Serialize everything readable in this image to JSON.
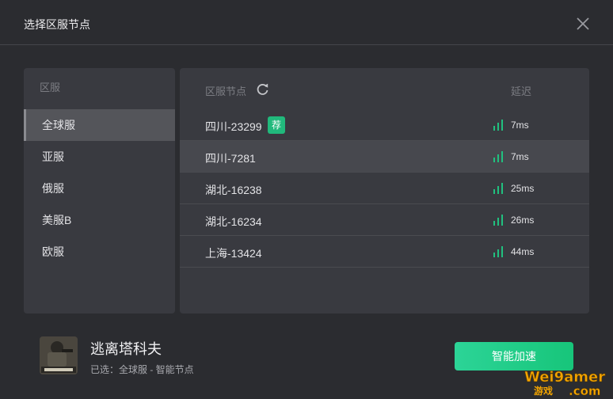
{
  "dialog": {
    "title": "选择区服节点"
  },
  "regions": {
    "header": "区服",
    "items": [
      {
        "label": "全球服",
        "selected": true
      },
      {
        "label": "亚服",
        "selected": false
      },
      {
        "label": "俄服",
        "selected": false
      },
      {
        "label": "美服B",
        "selected": false
      },
      {
        "label": "欧服",
        "selected": false
      }
    ]
  },
  "nodes": {
    "header": "区服节点",
    "latency_header": "延迟",
    "recommended_badge": "荐",
    "items": [
      {
        "name": "四川-23299",
        "latency": "7ms",
        "recommended": true,
        "selected": false
      },
      {
        "name": "四川-7281",
        "latency": "7ms",
        "recommended": false,
        "selected": true
      },
      {
        "name": "湖北-16238",
        "latency": "25ms",
        "recommended": false,
        "selected": false
      },
      {
        "name": "湖北-16234",
        "latency": "26ms",
        "recommended": false,
        "selected": false
      },
      {
        "name": "上海-13424",
        "latency": "44ms",
        "recommended": false,
        "selected": false
      }
    ]
  },
  "game": {
    "name": "逃离塔科夫",
    "selection": "已选：全球服 - 智能节点",
    "icon": "game-cover-icon"
  },
  "actions": {
    "accelerate_label": "智能加速"
  },
  "watermark": {
    "text": "Wei9amer",
    "suffix": ".com",
    "sub": "游戏"
  },
  "colors": {
    "accent": "#21b97c",
    "signal": "#21c07f",
    "background": "#2b2c30",
    "panel": "#393a40"
  }
}
